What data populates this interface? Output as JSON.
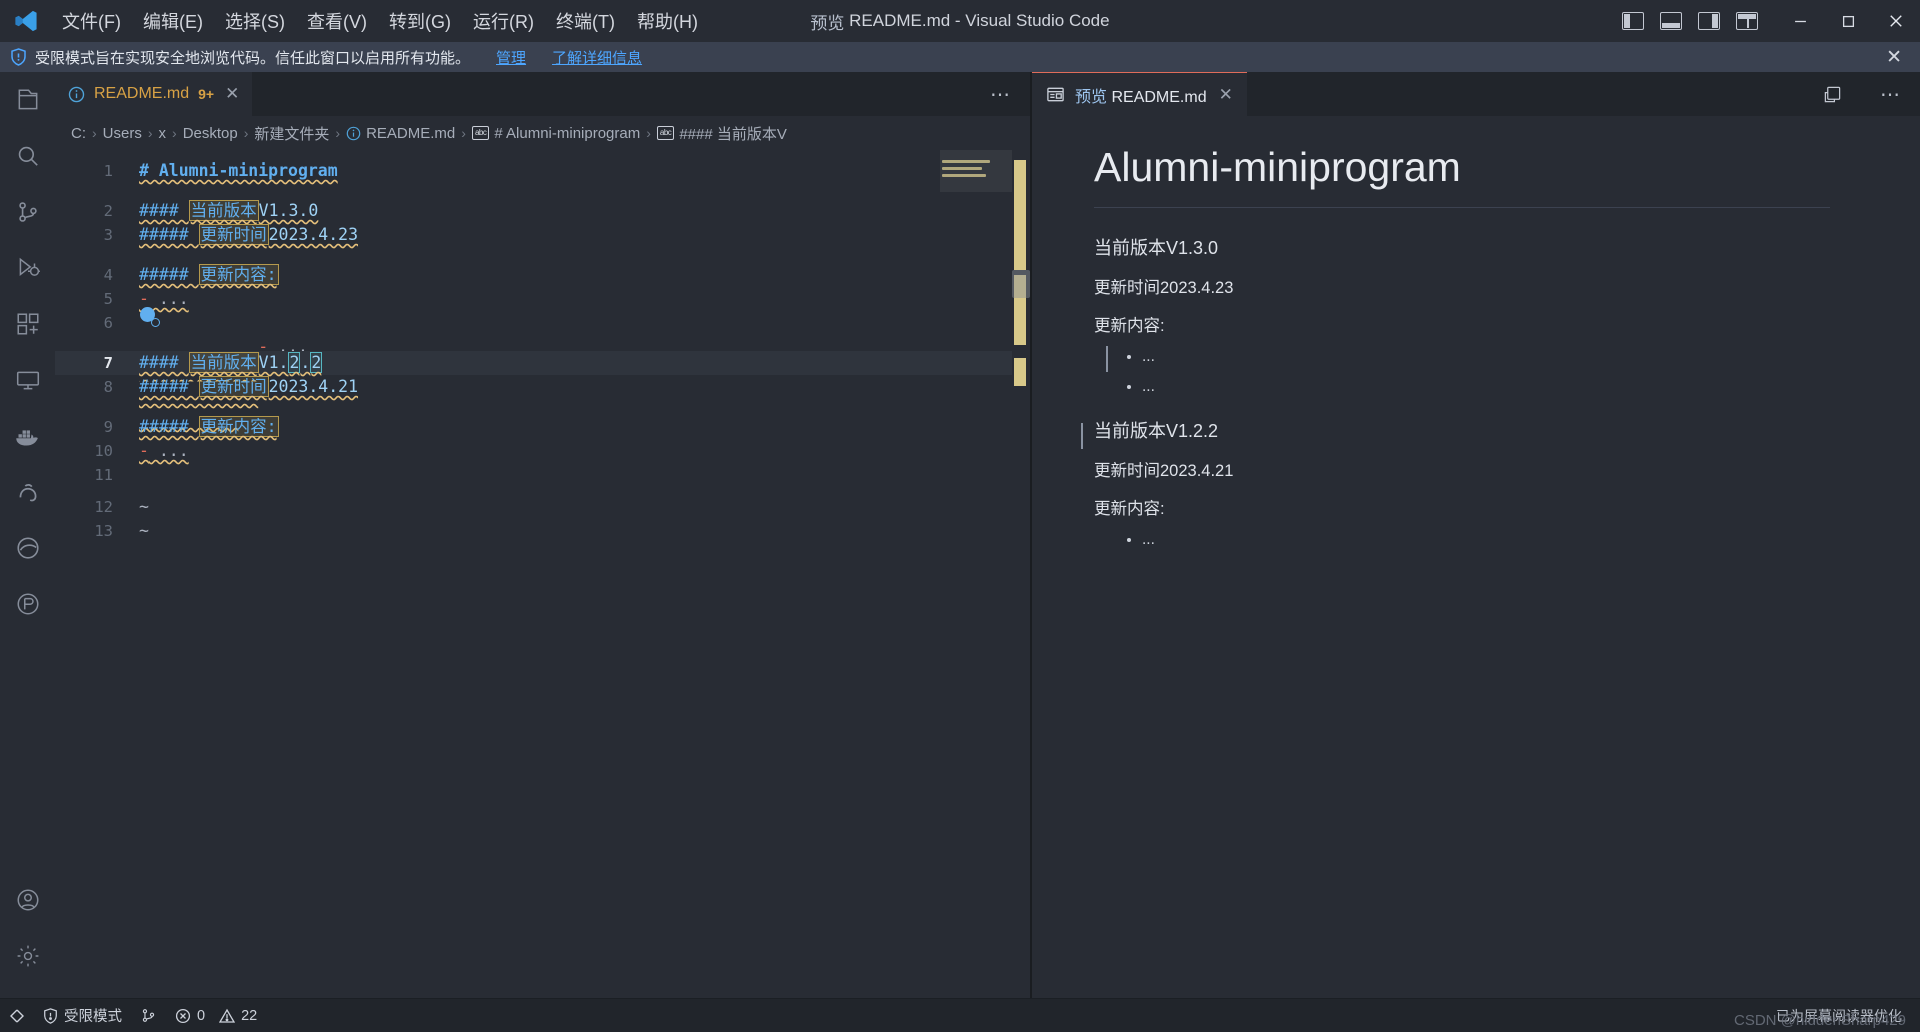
{
  "titlebar": {
    "logo_icon": "vscode-logo-icon",
    "window_title_prefix": "预览",
    "window_title": "README.md - Visual Studio Code",
    "menu": [
      {
        "label": "文件(F)",
        "name": "menu-file"
      },
      {
        "label": "编辑(E)",
        "name": "menu-edit"
      },
      {
        "label": "选择(S)",
        "name": "menu-selection"
      },
      {
        "label": "查看(V)",
        "name": "menu-view"
      },
      {
        "label": "转到(G)",
        "name": "menu-go"
      },
      {
        "label": "运行(R)",
        "name": "menu-run"
      },
      {
        "label": "终端(T)",
        "name": "menu-terminal"
      },
      {
        "label": "帮助(H)",
        "name": "menu-help"
      }
    ],
    "layout_icons": [
      "toggle-primary-sidebar-icon",
      "toggle-panel-icon",
      "toggle-secondary-sidebar-icon",
      "customize-layout-icon"
    ],
    "minimize_label": "─",
    "maximize_label": "□",
    "close_label": "✕"
  },
  "banner": {
    "shield_icon": "shield-icon",
    "text": "受限模式旨在实现安全地浏览代码。信任此窗口以启用所有功能。",
    "link_manage": "管理",
    "link_learn": "了解详细信息",
    "close_label": "✕"
  },
  "activitybar": {
    "items": [
      {
        "name": "explorer-icon",
        "label": "资源管理器"
      },
      {
        "name": "search-icon",
        "label": "搜索"
      },
      {
        "name": "source-control-icon",
        "label": "源代码管理"
      },
      {
        "name": "run-debug-icon",
        "label": "运行和调试"
      },
      {
        "name": "extensions-icon",
        "label": "扩展"
      },
      {
        "name": "remote-explorer-icon",
        "label": "远程资源管理器"
      },
      {
        "name": "docker-icon",
        "label": "Docker"
      },
      {
        "name": "anaconda-icon",
        "label": "Anaconda"
      },
      {
        "name": "edge-tools-icon",
        "label": "Edge 工具"
      },
      {
        "name": "gitlens-icon",
        "label": "GitLens"
      }
    ],
    "bottom_items": [
      {
        "name": "accounts-icon",
        "label": "账户"
      },
      {
        "name": "settings-gear-icon",
        "label": "管理"
      }
    ]
  },
  "editor_left": {
    "tab": {
      "icon": "info-circle-icon",
      "label": "README.md",
      "badge": "9+",
      "close_label": "✕"
    },
    "tab_actions_label": "⋯",
    "breadcrumbs": [
      {
        "label": "C:",
        "icon": null
      },
      {
        "label": "Users",
        "icon": null
      },
      {
        "label": "x",
        "icon": null
      },
      {
        "label": "Desktop",
        "icon": null
      },
      {
        "label": "新建文件夹",
        "icon": null
      },
      {
        "label": "README.md",
        "icon": "info-circle-icon"
      },
      {
        "label": "# Alumni-miniprogram",
        "icon": "abc-symbol-icon"
      },
      {
        "label": "#### 当前版本V",
        "icon": "abc-symbol-icon"
      }
    ],
    "separator": "›",
    "lines": [
      {
        "num": "1",
        "kind": "h1",
        "hashes": "# ",
        "cjk": "",
        "rest": "Alumni-miniprogram",
        "active": false
      },
      {
        "num": "2",
        "kind": "h4",
        "hashes": "#### ",
        "cjk": "当前版本",
        "rest": "V1.3.0",
        "active": false
      },
      {
        "num": "3",
        "kind": "h5",
        "hashes": "##### ",
        "cjk": "更新时间",
        "rest": "2023.4.23",
        "active": false
      },
      {
        "num": "4",
        "kind": "h5",
        "hashes": "##### ",
        "cjk": "更新内容:",
        "rest": "",
        "active": false
      },
      {
        "num": "5",
        "kind": "bullet",
        "hashes": "- ",
        "cjk": "",
        "rest": "...",
        "active": false
      },
      {
        "num": "6",
        "kind": "bullet-cursor",
        "hashes": "- ",
        "cjk": "",
        "rest": "...",
        "active": false
      },
      {
        "num": "7",
        "kind": "h4-sel",
        "hashes": "#### ",
        "cjk": "当前版本",
        "rest": "V1.2.2",
        "active": true
      },
      {
        "num": "8",
        "kind": "h5",
        "hashes": "##### ",
        "cjk": "更新时间",
        "rest": "2023.4.21",
        "active": false
      },
      {
        "num": "9",
        "kind": "h5",
        "hashes": "##### ",
        "cjk": "更新内容:",
        "rest": "",
        "active": false
      },
      {
        "num": "10",
        "kind": "bullet",
        "hashes": "- ",
        "cjk": "",
        "rest": "...",
        "active": false
      },
      {
        "num": "11",
        "kind": "blank",
        "hashes": "",
        "cjk": "",
        "rest": "",
        "active": false
      },
      {
        "num": "12",
        "kind": "tilde",
        "hashes": "",
        "cjk": "",
        "rest": "~",
        "active": false
      },
      {
        "num": "13",
        "kind": "tilde",
        "hashes": "",
        "cjk": "",
        "rest": "~",
        "active": false
      }
    ]
  },
  "editor_right": {
    "tab": {
      "icon": "preview-icon",
      "label_prefix": "预览",
      "label": "README.md",
      "close_label": "✕"
    },
    "actions": {
      "split_icon": "split-editor-icon",
      "more_label": "⋯"
    },
    "preview": {
      "h1": "Alumni-miniprogram",
      "blocks": [
        {
          "type": "h4",
          "text": "当前版本V1.3.0"
        },
        {
          "type": "h5",
          "text": "更新时间2023.4.23"
        },
        {
          "type": "h5",
          "text": "更新内容:"
        },
        {
          "type": "ul",
          "items": [
            "...",
            "..."
          ]
        },
        {
          "type": "h4",
          "text": "当前版本V1.2.2"
        },
        {
          "type": "h5",
          "text": "更新时间2023.4.21"
        },
        {
          "type": "h5",
          "text": "更新内容:"
        },
        {
          "type": "ul",
          "items": [
            "..."
          ]
        }
      ]
    }
  },
  "statusbar": {
    "remote_icon": "remote-window-icon",
    "trust_icon": "shield-icon",
    "trust_label": "受限模式",
    "branch_icon": "source-control-icon",
    "problems_error_icon": "error-circle-icon",
    "errors": "0",
    "problems_warn_icon": "warning-triangle-icon",
    "warnings": "22",
    "screen_reader_note": "已为屏幕阅读器优化",
    "watermark": "CSDN @hiddenSharp429"
  },
  "colors": {
    "titlebar_bg": "#282c34",
    "banner_bg": "#3a4150",
    "editor_bg": "#282c34",
    "accent_blue": "#61afef",
    "accent_orange": "#d8a245",
    "squiggle_yellow": "#e5c07b",
    "tab_active_border": "#e06c5a",
    "link_blue": "#4da6ff"
  }
}
